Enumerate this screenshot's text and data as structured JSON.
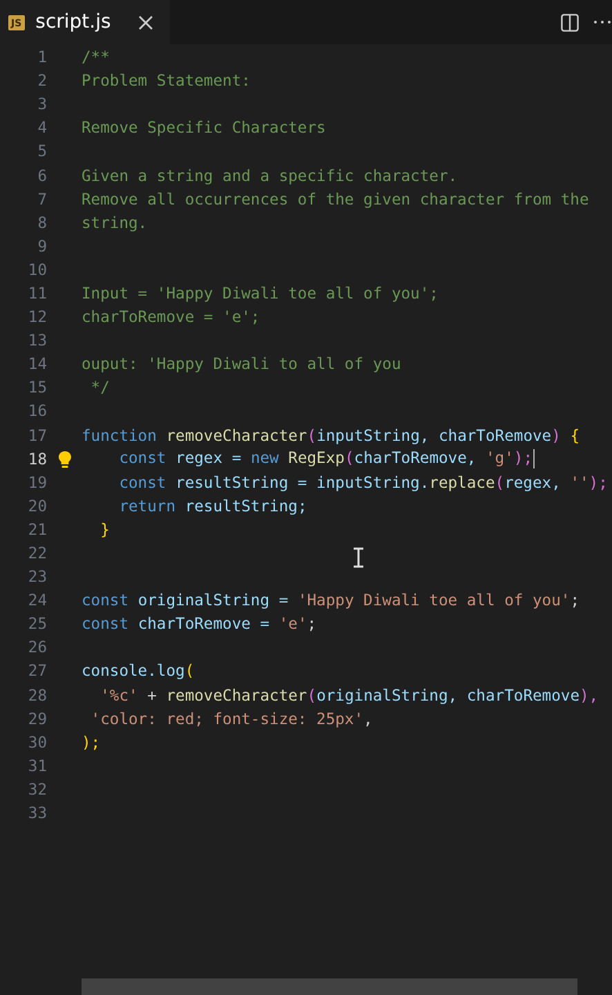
{
  "tab": {
    "label": "script.js",
    "badge": "JS",
    "selected": true
  },
  "lines": [
    {
      "number": "1",
      "current": false,
      "tokens": [
        {
          "kind": "comment",
          "text": "/**"
        }
      ]
    },
    {
      "number": "2",
      "current": false,
      "tokens": [
        {
          "kind": "comment",
          "text": "Problem Statement:"
        }
      ]
    },
    {
      "number": "3",
      "current": false
    },
    {
      "number": "4",
      "current": false,
      "tokens": [
        {
          "kind": "comment",
          "text": "Remove Specific Characters"
        }
      ]
    },
    {
      "number": "5",
      "current": false
    },
    {
      "number": "6",
      "current": false,
      "tokens": [
        {
          "kind": "comment",
          "text": "Given a string and a specific character."
        }
      ]
    },
    {
      "number": "7",
      "current": false,
      "tokens": [
        {
          "kind": "comment",
          "text": "Remove all occurrences of the given character from the"
        }
      ]
    },
    {
      "number": "8",
      "current": false,
      "tokens": [
        {
          "kind": "comment",
          "text": "string."
        }
      ]
    },
    {
      "number": "9",
      "current": false
    },
    {
      "number": "10",
      "current": false
    },
    {
      "number": "11",
      "current": false,
      "tokens": [
        {
          "kind": "comment",
          "text": "Input = 'Happy Diwali toe all of you';"
        }
      ]
    },
    {
      "number": "12",
      "current": false,
      "tokens": [
        {
          "kind": "comment",
          "text": "charToRemove = 'e';"
        }
      ]
    },
    {
      "number": "13",
      "current": false
    },
    {
      "number": "14",
      "current": false,
      "tokens": [
        {
          "kind": "comment",
          "text": "ouput: 'Happy Diwali to all of you"
        }
      ]
    },
    {
      "number": "15",
      "current": false,
      "tokens": [
        {
          "kind": "comment",
          "text": " */"
        }
      ]
    },
    {
      "number": "16",
      "current": false
    },
    {
      "number": "17",
      "current": false,
      "tokens": [
        {
          "kind": "keyword",
          "text": "function "
        },
        {
          "kind": "func",
          "text": "removeCharacter"
        },
        {
          "kind": "paren",
          "text": "("
        },
        {
          "kind": "var",
          "text": "inputString, charToRemove"
        },
        {
          "kind": "paren",
          "text": ") "
        },
        {
          "kind": "brace",
          "text": "{"
        }
      ]
    },
    {
      "number": "18",
      "current": true,
      "tokens": [
        {
          "kind": "keyword",
          "text": "    const "
        },
        {
          "kind": "var",
          "text": "regex = "
        },
        {
          "kind": "keyword",
          "text": "new "
        },
        {
          "kind": "func",
          "text": "RegExp"
        },
        {
          "kind": "paren",
          "text": "("
        },
        {
          "kind": "var",
          "text": "charToRemove, "
        },
        {
          "kind": "string",
          "text": "'g'"
        },
        {
          "kind": "paren",
          "text": ");"
        }
      ]
    },
    {
      "number": "19",
      "current": false,
      "tokens": [
        {
          "kind": "keyword",
          "text": "    const "
        },
        {
          "kind": "var",
          "text": "resultString = inputString."
        },
        {
          "kind": "func",
          "text": "replace"
        },
        {
          "kind": "paren",
          "text": "("
        },
        {
          "kind": "var",
          "text": "regex, "
        },
        {
          "kind": "string",
          "text": "''"
        },
        {
          "kind": "paren",
          "text": ");"
        }
      ]
    },
    {
      "number": "20",
      "current": false,
      "tokens": [
        {
          "kind": "keyword",
          "text": "    return "
        },
        {
          "kind": "var",
          "text": "resultString;"
        }
      ]
    },
    {
      "number": "21",
      "current": false,
      "tokens": [
        {
          "kind": "brace",
          "text": "  }"
        }
      ]
    },
    {
      "number": "22",
      "current": false
    },
    {
      "number": "23",
      "current": false
    },
    {
      "number": "24",
      "current": false,
      "tokens": [
        {
          "kind": "keyword",
          "text": "const "
        },
        {
          "kind": "var",
          "text": "originalString = "
        },
        {
          "kind": "string",
          "text": "'Happy Diwali toe all of you'"
        },
        {
          "kind": "plain",
          "text": ";"
        }
      ]
    },
    {
      "number": "25",
      "current": false,
      "tokens": [
        {
          "kind": "keyword",
          "text": "const "
        },
        {
          "kind": "var",
          "text": "charToRemove = "
        },
        {
          "kind": "string",
          "text": "'e'"
        },
        {
          "kind": "plain",
          "text": ";"
        }
      ]
    },
    {
      "number": "26",
      "current": false
    },
    {
      "number": "27",
      "current": false,
      "tokens": [
        {
          "kind": "var",
          "text": "console.log"
        },
        {
          "kind": "brace",
          "text": "("
        }
      ]
    },
    {
      "number": "28",
      "current": false,
      "tokens": [
        {
          "kind": "string",
          "text": "  '%c'"
        },
        {
          "kind": "plain",
          "text": " + "
        },
        {
          "kind": "func",
          "text": "removeCharacter"
        },
        {
          "kind": "paren",
          "text": "("
        },
        {
          "kind": "var",
          "text": "originalString, charToRemove"
        },
        {
          "kind": "paren",
          "text": "),"
        }
      ]
    },
    {
      "number": "29",
      "current": false,
      "tokens": [
        {
          "kind": "string",
          "text": " 'color: red; font-size: 25px'"
        },
        {
          "kind": "plain",
          "text": ","
        }
      ]
    },
    {
      "number": "30",
      "current": false,
      "tokens": [
        {
          "kind": "brace",
          "text": ");"
        }
      ]
    },
    {
      "number": "31",
      "current": false
    },
    {
      "number": "32",
      "current": false
    },
    {
      "number": "33",
      "current": false
    }
  ]
}
